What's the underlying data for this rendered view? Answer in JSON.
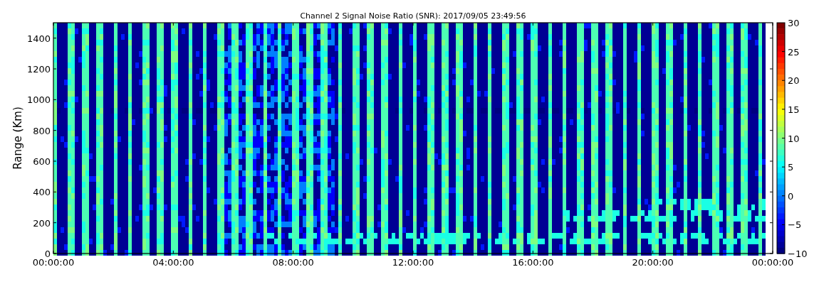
{
  "plot": {
    "title": "Channel 2 Signal Noise Ratio (SNR): 2017/09/05 23:49:56",
    "ylabel": "Range (Km)",
    "yticks": [
      "1400",
      "1200",
      "1000",
      "800",
      "600",
      "400",
      "200",
      "0"
    ],
    "xticks": [
      "00:00:00",
      "04:00:00",
      "08:00:00",
      "12:00:00",
      "16:00:00",
      "20:00:00",
      "00:00:00"
    ],
    "colorbar": {
      "ticks": [
        "30",
        "25",
        "20",
        "15",
        "10",
        "5",
        "0",
        "−5",
        "−10"
      ]
    }
  }
}
